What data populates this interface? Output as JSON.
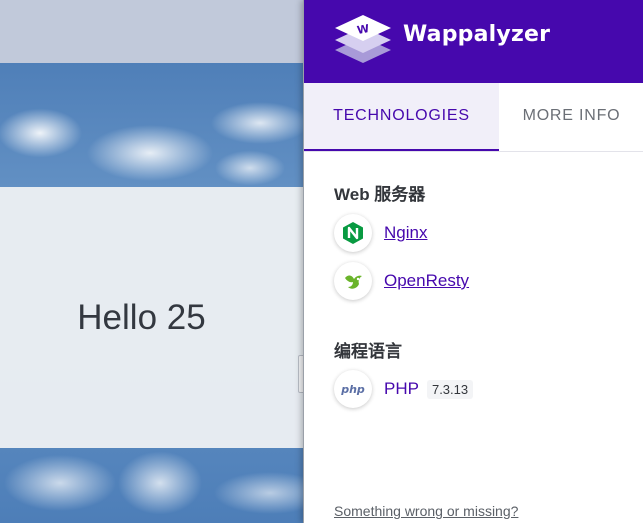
{
  "webpage": {
    "hello_text": "Hello 25"
  },
  "popup": {
    "brand": "Wappalyzer",
    "tabs": [
      {
        "label": "TECHNOLOGIES",
        "active": true
      },
      {
        "label": "MORE INFO",
        "active": false
      }
    ],
    "categories": [
      {
        "title": "Web 服务器",
        "items": [
          {
            "name": "Nginx",
            "icon": "nginx-icon"
          },
          {
            "name": "OpenResty",
            "icon": "openresty-icon"
          }
        ]
      },
      {
        "title": "编程语言",
        "items": [
          {
            "name": "PHP",
            "version": "7.3.13",
            "icon": "php-icon",
            "icon_text": "php"
          }
        ]
      }
    ],
    "footer_link": "Something wrong or missing?",
    "colors": {
      "brand_purple": "#4608ad",
      "nginx_green": "#089a41",
      "openresty_green": "#6ab42a"
    }
  }
}
